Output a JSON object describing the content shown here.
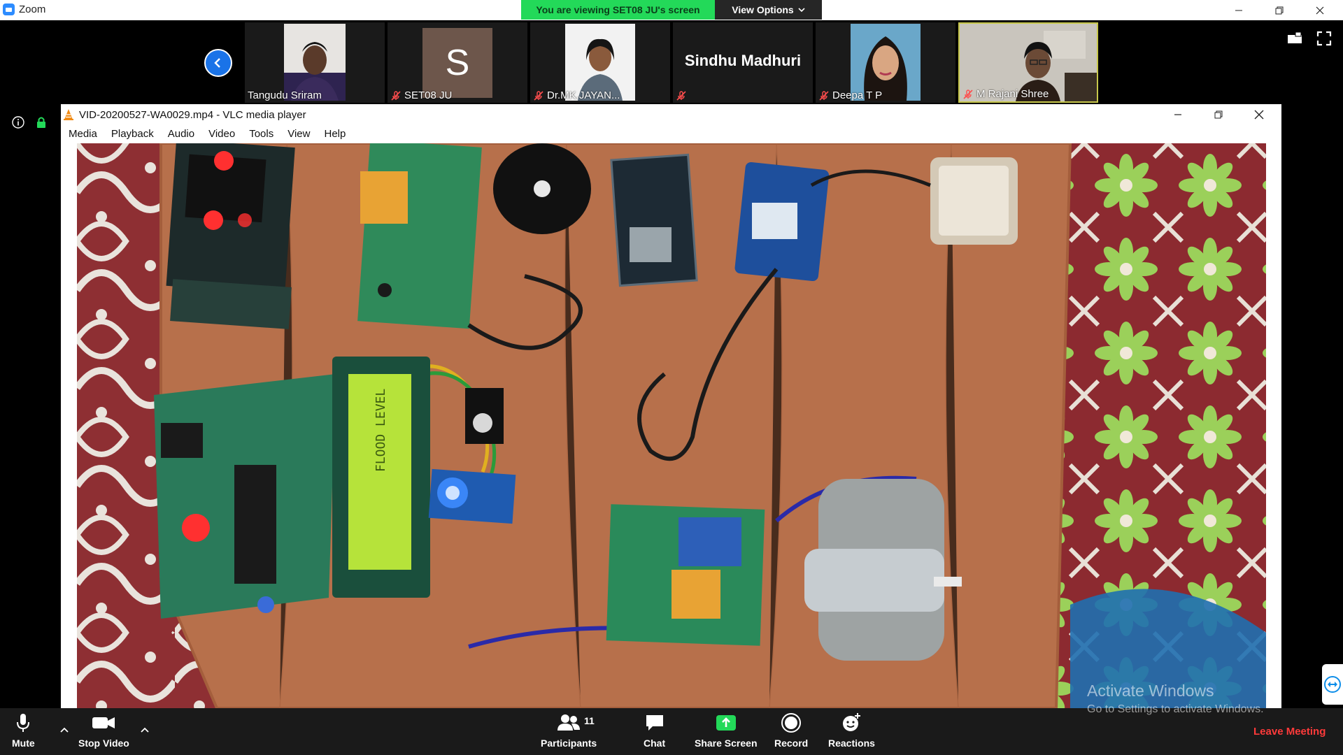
{
  "zoom": {
    "app_title": "Zoom",
    "viewing_banner": "You are viewing SET08 JU's screen",
    "view_options": "View Options"
  },
  "participants": [
    {
      "name": "Tangudu Sriram",
      "muted": false
    },
    {
      "name": "SET08 JU",
      "muted": true,
      "initial": "S"
    },
    {
      "name": "Dr.MK.JAYAN...",
      "muted": true
    },
    {
      "name": "Sindhu Madhuri",
      "muted": true
    },
    {
      "name": "Deepa T P",
      "muted": true
    },
    {
      "name": "M Rajani Shree",
      "muted": true
    }
  ],
  "vlc": {
    "title": "VID-20200527-WA0029.mp4 - VLC media player",
    "menu": [
      "Media",
      "Playback",
      "Audio",
      "Video",
      "Tools",
      "View",
      "Help"
    ]
  },
  "toolbar": {
    "mute": "Mute",
    "stop_video": "Stop Video",
    "participants": "Participants",
    "participant_count": "11",
    "chat": "Chat",
    "share_screen": "Share Screen",
    "record": "Record",
    "reactions": "Reactions",
    "leave": "Leave Meeting"
  },
  "watermark": {
    "line1": "Activate Windows",
    "line2": "Go to Settings to activate Windows."
  },
  "colors": {
    "zoom_green": "#23d959",
    "zoom_blue": "#2d8cff",
    "leave_red": "#ff3a3a",
    "lcd_green": "#b6e33a"
  }
}
